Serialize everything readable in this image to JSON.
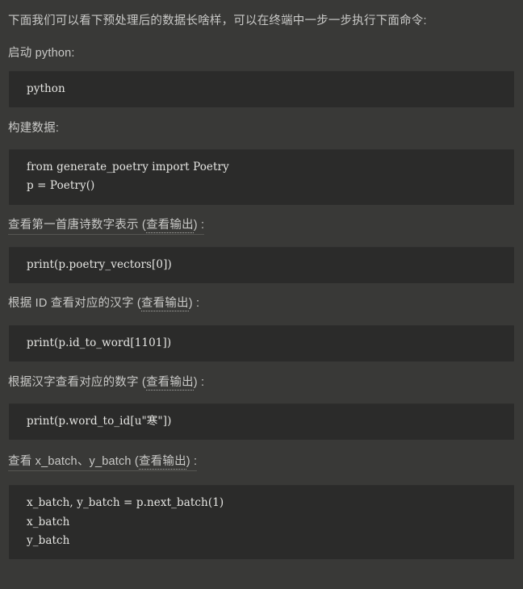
{
  "page": {
    "background_color": "#393937",
    "code_background_color": "#2b2b2a",
    "text_color": "#c9c9c7",
    "code_text_color": "#e6e6e3"
  },
  "intro": {
    "text": "下面我们可以看下预处理后的数据长啥样，可以在终端中一步一步执行下面命令:"
  },
  "sections": [
    {
      "heading_prefix": "启动 python",
      "heading_link": "",
      "heading_suffix": ":",
      "code": "python"
    },
    {
      "heading_prefix": "构建数据",
      "heading_link": "",
      "heading_suffix": ":",
      "code": "from generate_poetry import Poetry\np = Poetry()"
    },
    {
      "heading_prefix": "查看第一首唐诗数字表示 (",
      "heading_link": "查看输出",
      "heading_suffix": ") :",
      "code": "print(p.poetry_vectors[0])"
    },
    {
      "heading_prefix": "根据 ID 查看对应的汉字 (",
      "heading_link": "查看输出",
      "heading_suffix": ") :",
      "code": "print(p.id_to_word[1101])"
    },
    {
      "heading_prefix": "根据汉字查看对应的数字 (",
      "heading_link": "查看输出",
      "heading_suffix": ") :",
      "code": "print(p.word_to_id[u\"寒\"])"
    },
    {
      "heading_prefix": "查看 x_batch、y_batch (",
      "heading_link": "查看输出",
      "heading_suffix": ") :",
      "code": "x_batch, y_batch = p.next_batch(1)\nx_batch\ny_batch"
    }
  ]
}
